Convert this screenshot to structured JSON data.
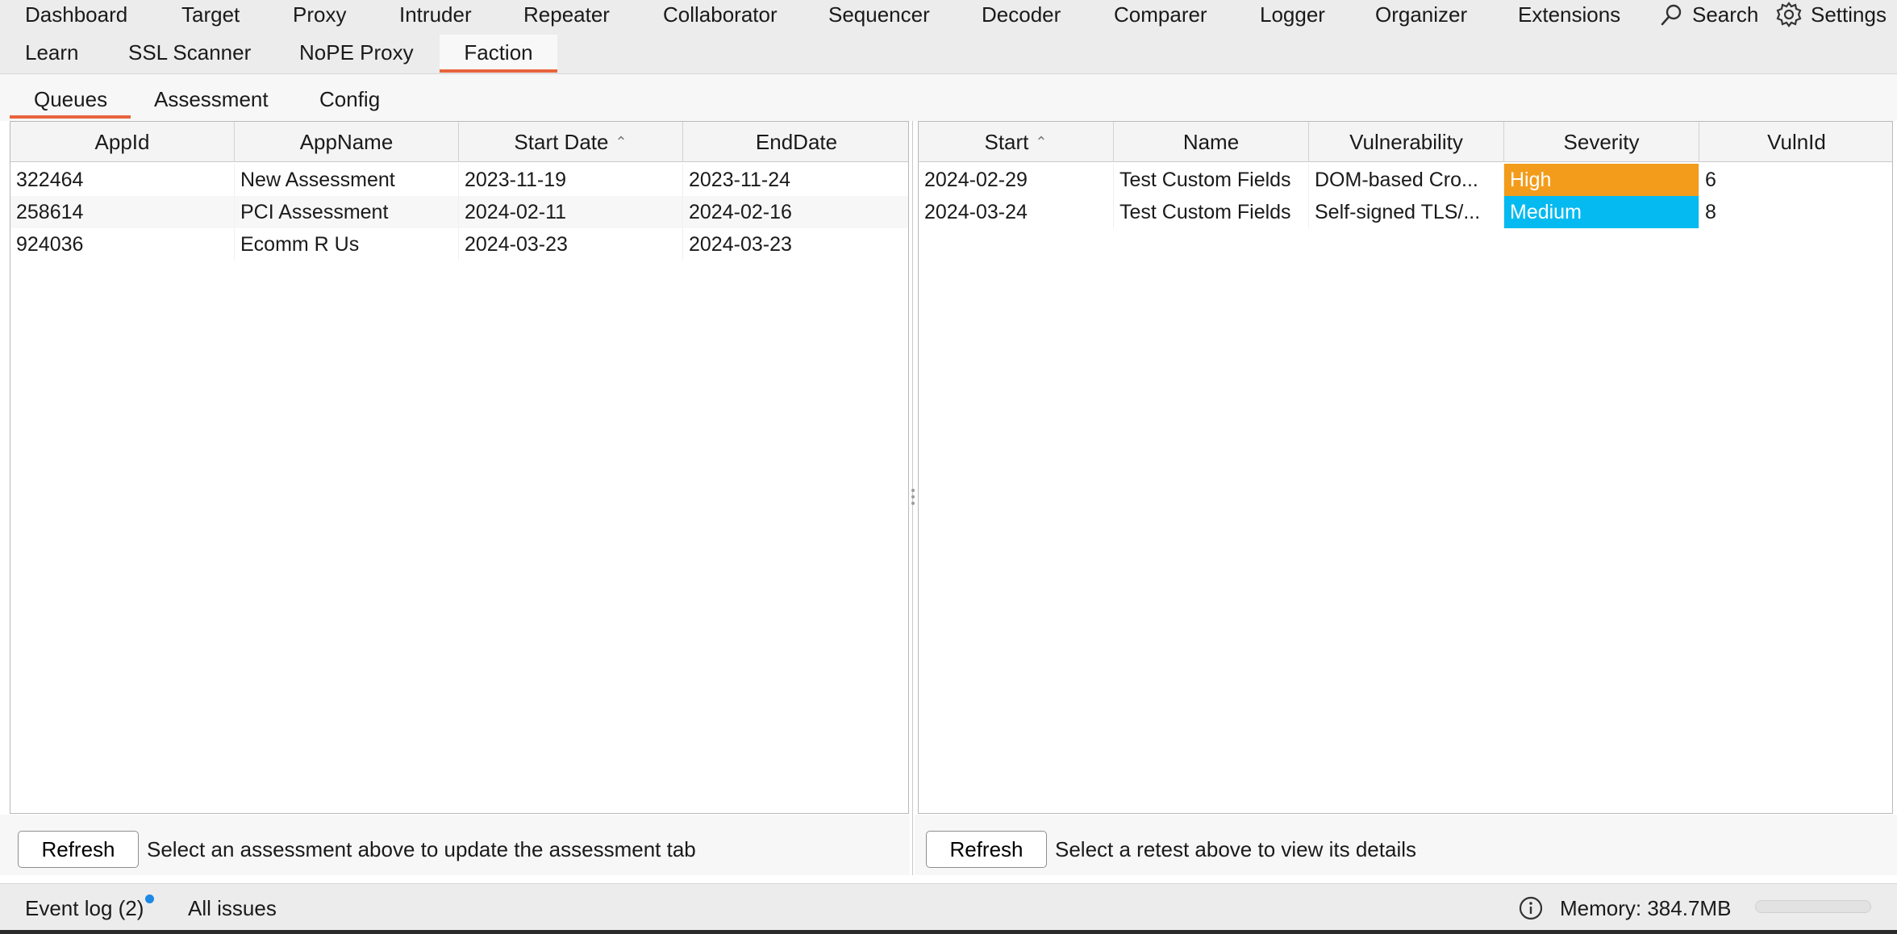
{
  "top_tabs_row1": [
    "Dashboard",
    "Target",
    "Proxy",
    "Intruder",
    "Repeater",
    "Collaborator",
    "Sequencer",
    "Decoder",
    "Comparer",
    "Logger",
    "Organizer",
    "Extensions"
  ],
  "top_tabs_row2": [
    "Learn",
    "SSL Scanner",
    "NoPE Proxy",
    "Faction"
  ],
  "toolbar": {
    "search_label": "Search",
    "settings_label": "Settings"
  },
  "sub_tabs": [
    "Queues",
    "Assessment",
    "Config"
  ],
  "left_table": {
    "headers": [
      "AppId",
      "AppName",
      "Start Date",
      "EndDate"
    ],
    "rows": [
      [
        "322464",
        "New Assessment",
        "2023-11-19",
        "2023-11-24"
      ],
      [
        "258614",
        "PCI Assessment",
        "2024-02-11",
        "2024-02-16"
      ],
      [
        "924036",
        "Ecomm R Us",
        "2024-03-23",
        "2024-03-23"
      ]
    ]
  },
  "right_table": {
    "headers": [
      "Start",
      "Name",
      "Vulnerability",
      "Severity",
      "VulnId"
    ],
    "rows": [
      [
        "2024-02-29",
        "Test Custom Fields",
        "DOM-based Cro...",
        "High",
        "6"
      ],
      [
        "2024-03-24",
        "Test Custom Fields",
        "Self-signed TLS/...",
        "Medium",
        "8"
      ]
    ]
  },
  "severity_colors": {
    "High": "#f39c1b",
    "Medium": "#05baf0"
  },
  "accent_color": "#e8643c",
  "left_controls": {
    "refresh_label": "Refresh",
    "hint": "Select an assessment above to update the assessment tab"
  },
  "right_controls": {
    "refresh_label": "Refresh",
    "hint": "Select a retest above to view its details"
  },
  "status": {
    "event_log": "Event log (2)",
    "all_issues": "All issues",
    "memory": "Memory: 384.7MB"
  }
}
